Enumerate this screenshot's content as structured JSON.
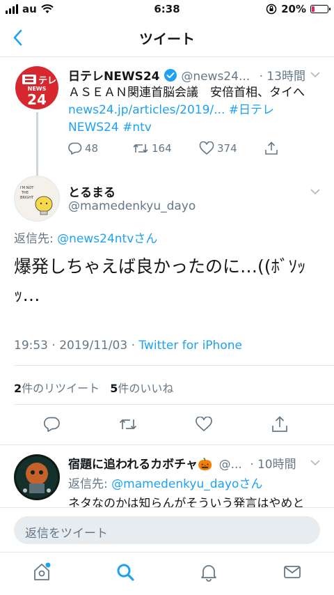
{
  "status": {
    "carrier": "au",
    "time": "6:38",
    "battery": "20%",
    "battery_level": 0.2
  },
  "header": {
    "title": "ツイート"
  },
  "parent_tweet": {
    "name": "日テレNEWS24",
    "handle": "@news24...",
    "time": "· 13時間",
    "line1": "ＡＳＥＡＮ関連首脳会議　安倍首相、タイへ",
    "line2_link": "news24.jp/articles/2019/...",
    "line2_tag": " #日テレ",
    "line3": "NEWS24 #ntv",
    "replies": "48",
    "retweets": "164",
    "likes": "374"
  },
  "main_tweet": {
    "name": "とるまる",
    "handle": "@mamedenkyu_dayo",
    "reply_to_label": "返信先: ",
    "reply_to_user": "@news24ntvさん",
    "text_line1": "爆発しちゃえば良かったのに…((ﾎﾞｿｯ",
    "text_line2": "ｯ…",
    "time": "19:53 · 2019/11/03 · ",
    "client": "Twitter for iPhone",
    "retweet_count": "2",
    "retweet_label": "件のリツイート",
    "like_count": "5",
    "like_label": "件のいいね"
  },
  "reply_tweet": {
    "name": "宿題に追われるカボチャ🎃",
    "handle": "@...",
    "time": "· 10時間",
    "reply_to_label": "返信先: ",
    "reply_to_user": "@mamedenkyu_dayoさん",
    "text": "ネタなのかは知らんがそういう発言はやめと"
  },
  "reply_bar": {
    "placeholder": "返信をツイート"
  },
  "colors": {
    "accent": "#1da1f2",
    "muted": "#657786",
    "border": "#e1e8ed",
    "logo_red": "#d7282f"
  }
}
